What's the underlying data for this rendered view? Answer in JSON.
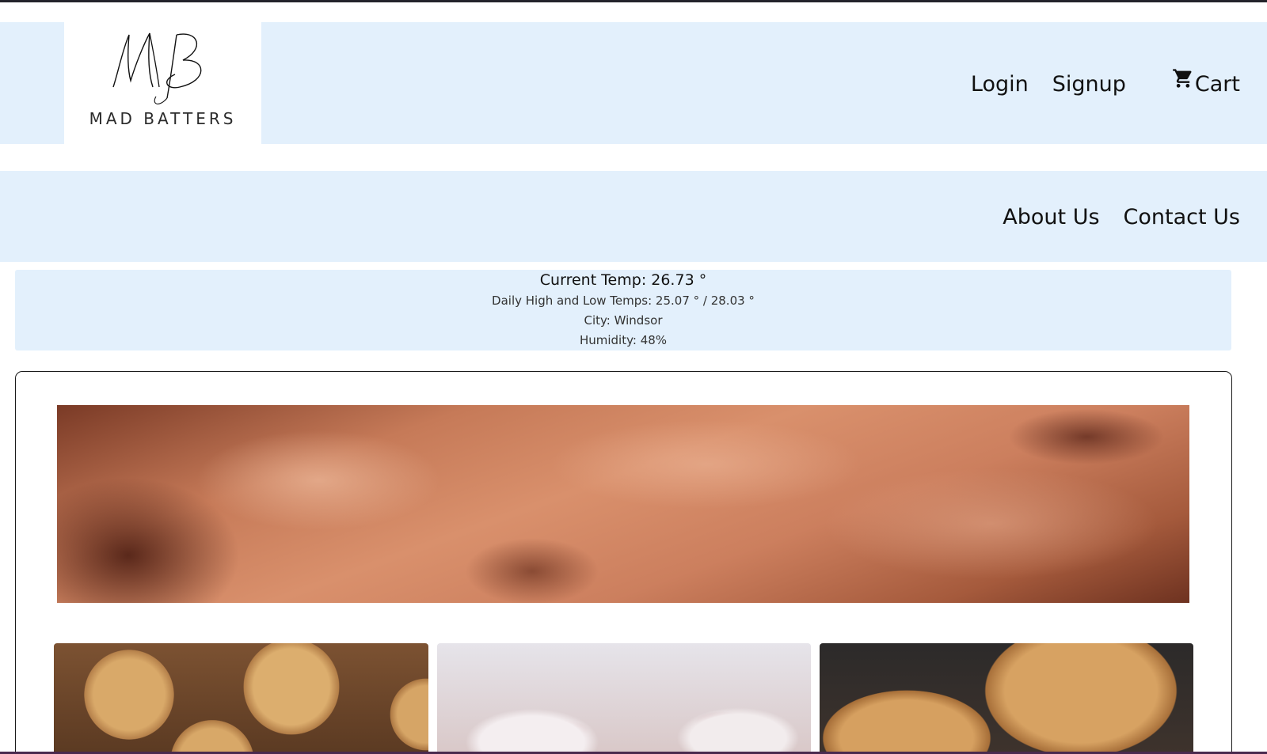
{
  "brand": {
    "monogram": "MB",
    "name": "MAD BATTERS"
  },
  "header": {
    "login_label": "Login",
    "signup_label": "Signup",
    "cart_label": "Cart",
    "cart_icon": "cart-icon"
  },
  "nav": {
    "about_label": "About Us",
    "contact_label": "Contact Us"
  },
  "weather": {
    "current": "Current Temp: 26.73 °",
    "high_low": "Daily High and Low Temps: 25.07 ° / 28.03 °",
    "city": "City: Windsor",
    "humidity": "Humidity: 48%"
  },
  "colors": {
    "band": "#e3f0fc",
    "card_border": "#1a1a1a",
    "text": "#111111"
  }
}
